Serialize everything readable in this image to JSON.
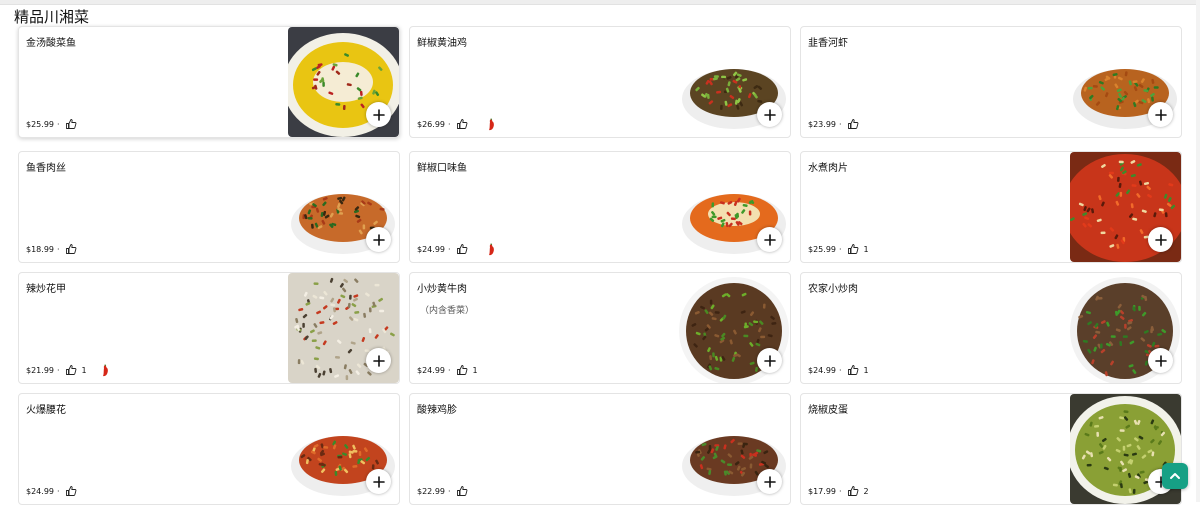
{
  "section": {
    "title": "精品川湘菜"
  },
  "colors": {
    "accent": "#16a085",
    "chili": "#d62718"
  },
  "items": [
    {
      "name": "金汤酸菜鱼",
      "price": "$25.99",
      "sep": "·",
      "likes": "",
      "spicy": false,
      "note": "",
      "image": "golden-broth-fish"
    },
    {
      "name": "鲜椒黄油鸡",
      "price": "$26.99",
      "sep": "·",
      "likes": "",
      "spicy": true,
      "note": "",
      "image": "pepper-chicken"
    },
    {
      "name": "韭香河虾",
      "price": "$23.99",
      "sep": "·",
      "likes": "",
      "spicy": false,
      "note": "",
      "image": "chive-shrimp"
    },
    {
      "name": "鱼香肉丝",
      "price": "$18.99",
      "sep": "·",
      "likes": "",
      "spicy": false,
      "note": "",
      "image": "yuxiang-pork"
    },
    {
      "name": "鲜椒口味鱼",
      "price": "$24.99",
      "sep": "·",
      "likes": "",
      "spicy": true,
      "note": "",
      "image": "pepper-fish"
    },
    {
      "name": "水煮肉片",
      "price": "$25.99",
      "sep": "·",
      "likes": "1",
      "spicy": false,
      "note": "",
      "image": "boiled-pork"
    },
    {
      "name": "辣炒花甲",
      "price": "$21.99",
      "sep": "·",
      "likes": "1",
      "spicy": true,
      "note": "",
      "image": "spicy-clams"
    },
    {
      "name": "小炒黄牛肉",
      "price": "$24.99",
      "sep": "·",
      "likes": "1",
      "spicy": false,
      "note": "（内含香菜）",
      "image": "stir-fry-beef"
    },
    {
      "name": "农家小炒肉",
      "price": "$24.99",
      "sep": "·",
      "likes": "1",
      "spicy": false,
      "note": "",
      "image": "farm-pork"
    },
    {
      "name": "火爆腰花",
      "price": "$24.99",
      "sep": "·",
      "likes": "",
      "spicy": false,
      "note": "",
      "image": "kidney"
    },
    {
      "name": "酸辣鸡胗",
      "price": "$22.99",
      "sep": "·",
      "likes": "",
      "spicy": false,
      "note": "",
      "image": "gizzard"
    },
    {
      "name": "烧椒皮蛋",
      "price": "$17.99",
      "sep": "·",
      "likes": "2",
      "spicy": false,
      "note": "",
      "image": "century-egg"
    }
  ]
}
